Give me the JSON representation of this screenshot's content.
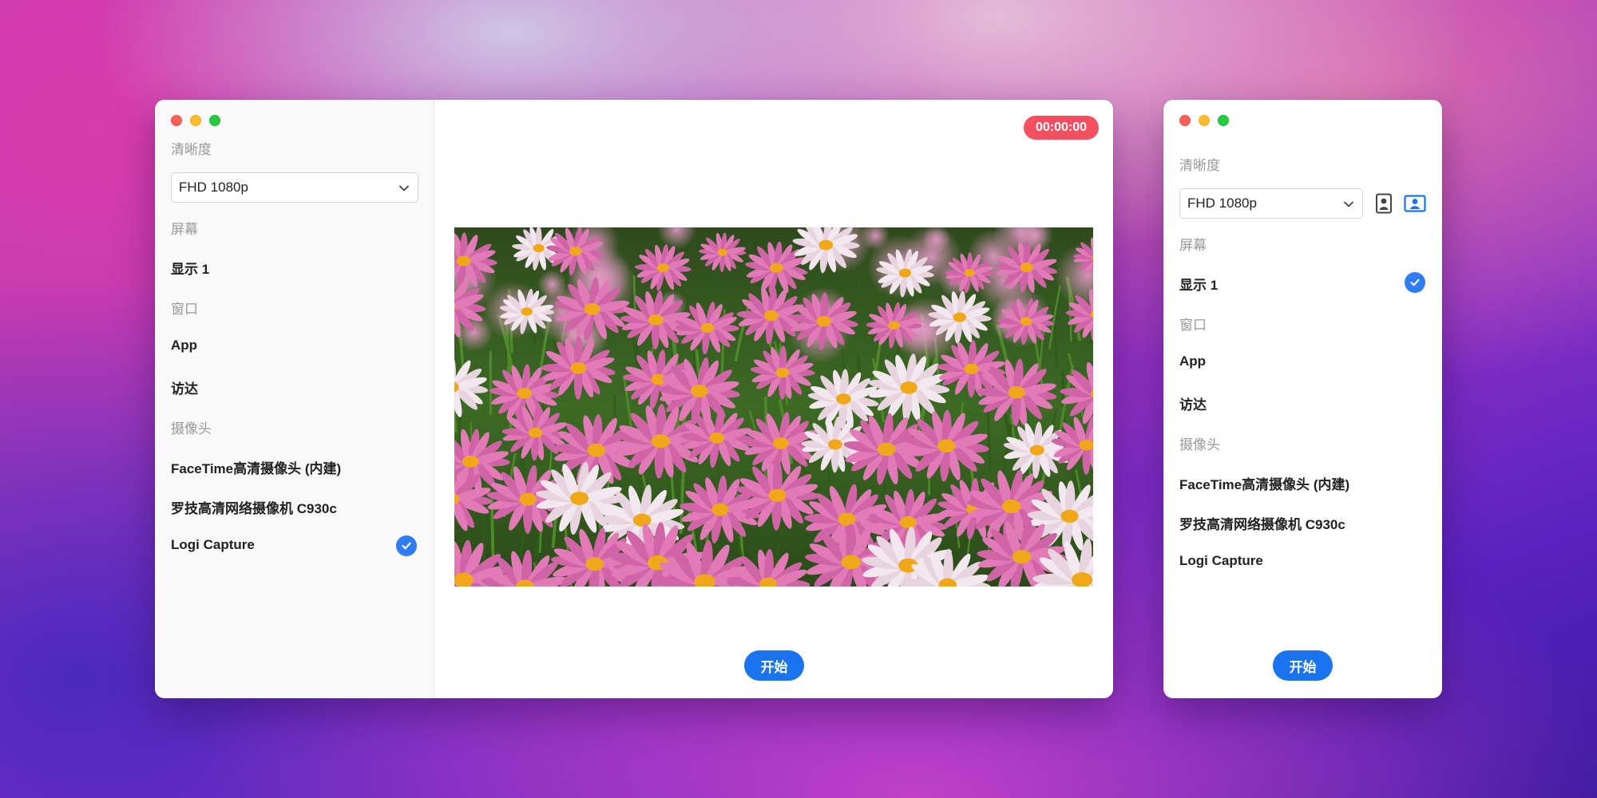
{
  "colors": {
    "accent": "#1b73f0",
    "check": "#2f7cf6",
    "timer": "#f4505f",
    "section_text": "#9a9a9a"
  },
  "icons": [
    "close-dot",
    "minimize-dot",
    "zoom-dot",
    "chevron-down-icon",
    "checkmark-icon",
    "portrait-mode-icon",
    "landscape-mode-icon"
  ],
  "window_main": {
    "sidebar": {
      "resolution_label": "清晰度",
      "resolution_value": "FHD 1080p",
      "screen_label": "屏幕",
      "screen_items": [
        "显示 1"
      ],
      "window_label": "窗口",
      "window_items": [
        "App",
        "访达"
      ],
      "camera_label": "摄像头",
      "camera_items": [
        "FaceTime高清摄像头 (内建)",
        "罗技高清网络摄像机 C930c",
        "Logi Capture"
      ],
      "selected_item": "Logi Capture"
    },
    "timer": "00:00:00",
    "start_label": "开始"
  },
  "window_compact": {
    "resolution_label": "清晰度",
    "resolution_value": "FHD 1080p",
    "screen_label": "屏幕",
    "screen_items": [
      "显示 1"
    ],
    "window_label": "窗口",
    "window_items": [
      "App",
      "访达"
    ],
    "camera_label": "摄像头",
    "camera_items": [
      "FaceTime高清摄像头 (内建)",
      "罗技高清网络摄像机 C930c",
      "Logi Capture"
    ],
    "selected_item": "显示 1",
    "active_mode": "landscape",
    "start_label": "开始"
  }
}
